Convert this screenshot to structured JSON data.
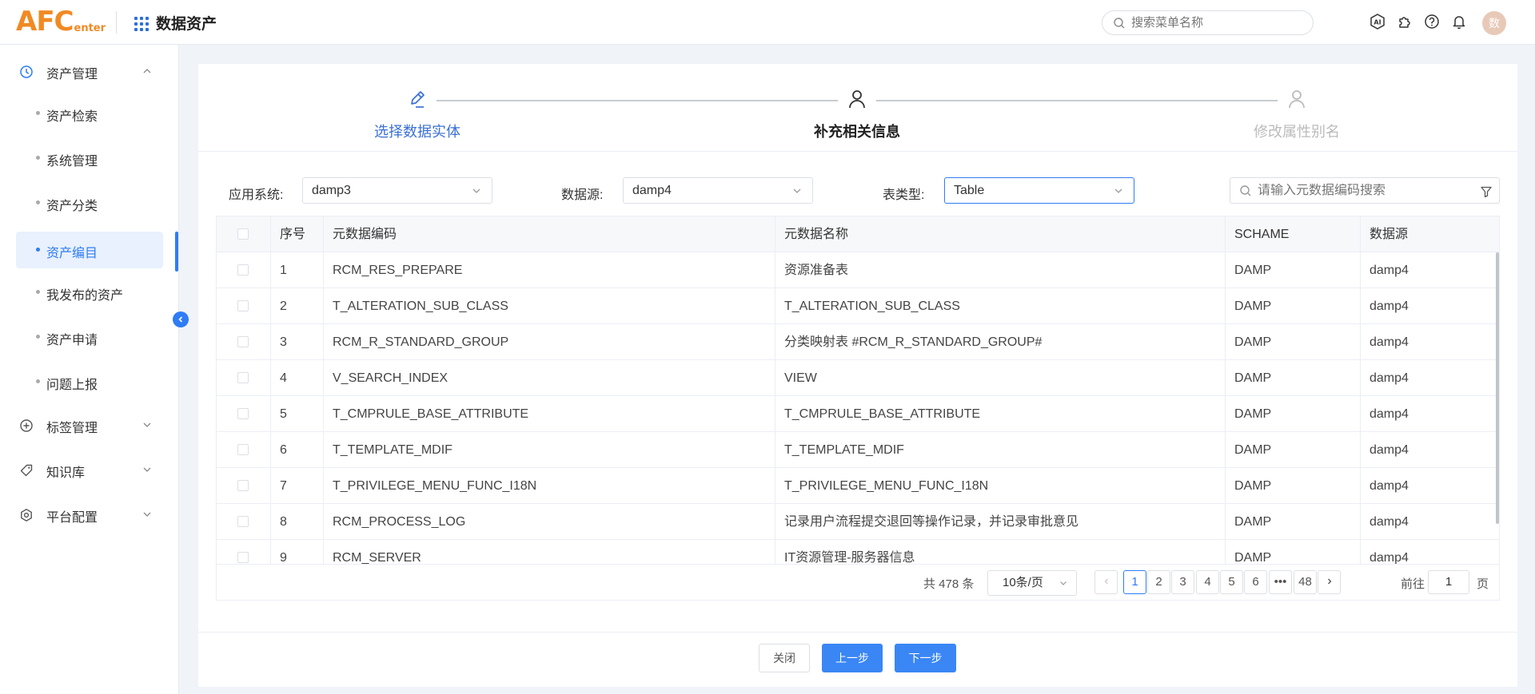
{
  "header": {
    "logo_main": "AFC",
    "logo_sub": "enter",
    "title": "数据资产",
    "search_placeholder": "搜索菜单名称",
    "avatar_text": "数"
  },
  "sidebar": {
    "groups": [
      {
        "label": "资产管理",
        "icon": "clock-icon",
        "expanded": true
      },
      {
        "label": "标签管理",
        "icon": "plus-circle-icon",
        "expanded": false
      },
      {
        "label": "知识库",
        "icon": "tag-icon",
        "expanded": false
      },
      {
        "label": "平台配置",
        "icon": "settings-icon",
        "expanded": false
      }
    ],
    "items": [
      {
        "label": "资产检索"
      },
      {
        "label": "系统管理"
      },
      {
        "label": "资产分类"
      },
      {
        "label": "资产编目",
        "active": true
      },
      {
        "label": "我发布的资产"
      },
      {
        "label": "资产申请"
      },
      {
        "label": "问题上报"
      }
    ]
  },
  "steps": [
    {
      "label": "选择数据实体",
      "state": "done"
    },
    {
      "label": "补充相关信息",
      "state": "current"
    },
    {
      "label": "修改属性别名",
      "state": "pending"
    }
  ],
  "filters": {
    "app_label": "应用系统:",
    "app_value": "damp3",
    "ds_label": "数据源:",
    "ds_value": "damp4",
    "type_label": "表类型:",
    "type_value": "Table",
    "search_placeholder": "请输入元数据编码搜索"
  },
  "table": {
    "columns": [
      "序号",
      "元数据编码",
      "元数据名称",
      "SCHAME",
      "数据源"
    ],
    "rows": [
      [
        "1",
        "RCM_RES_PREPARE",
        "资源准备表",
        "DAMP",
        "damp4"
      ],
      [
        "2",
        "T_ALTERATION_SUB_CLASS",
        "T_ALTERATION_SUB_CLASS",
        "DAMP",
        "damp4"
      ],
      [
        "3",
        "RCM_R_STANDARD_GROUP",
        "分类映射表 #RCM_R_STANDARD_GROUP#",
        "DAMP",
        "damp4"
      ],
      [
        "4",
        "V_SEARCH_INDEX",
        "VIEW",
        "DAMP",
        "damp4"
      ],
      [
        "5",
        "T_CMPRULE_BASE_ATTRIBUTE",
        "T_CMPRULE_BASE_ATTRIBUTE",
        "DAMP",
        "damp4"
      ],
      [
        "6",
        "T_TEMPLATE_MDIF",
        "T_TEMPLATE_MDIF",
        "DAMP",
        "damp4"
      ],
      [
        "7",
        "T_PRIVILEGE_MENU_FUNC_I18N",
        "T_PRIVILEGE_MENU_FUNC_I18N",
        "DAMP",
        "damp4"
      ],
      [
        "8",
        "RCM_PROCESS_LOG",
        "记录用户流程提交退回等操作记录，并记录审批意见",
        "DAMP",
        "damp4"
      ],
      [
        "9",
        "RCM_SERVER",
        "IT资源管理-服务器信息",
        "DAMP",
        "damp4"
      ]
    ]
  },
  "pagination": {
    "total": "共 478 条",
    "page_size": "10条/页",
    "pages": [
      "1",
      "2",
      "3",
      "4",
      "5",
      "6",
      "•••",
      "48"
    ],
    "current": "1",
    "goto_label": "前往",
    "goto_value": "1",
    "page_suffix": "页"
  },
  "footer": {
    "close": "关闭",
    "prev": "上一步",
    "next": "下一步"
  },
  "colors": {
    "primary": "#2e7cf6",
    "logo": "#f08a24"
  }
}
